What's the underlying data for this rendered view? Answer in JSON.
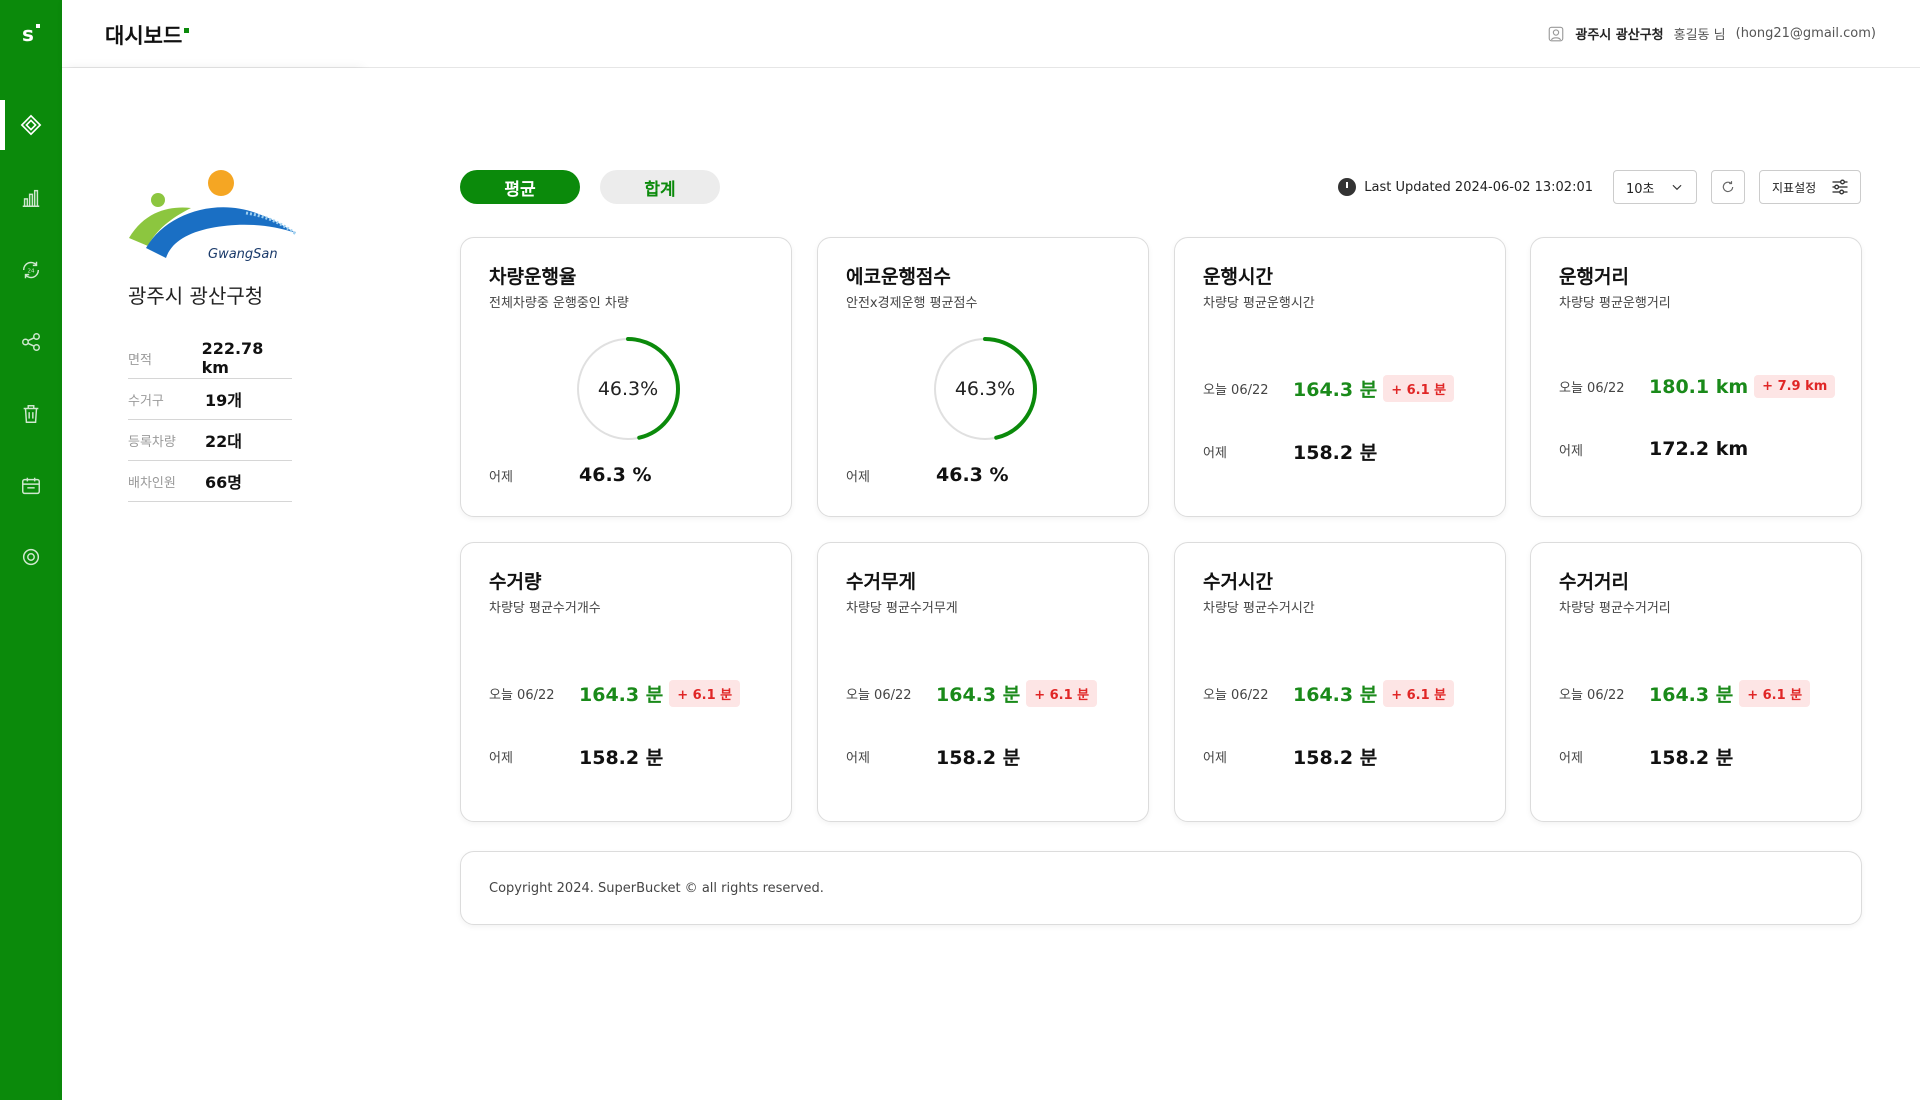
{
  "app": {
    "brand": "s",
    "page_title": "대시보드"
  },
  "user": {
    "org": "광주시 광산구청",
    "name": "홍길동 님",
    "email": "(hong21@gmail.com)"
  },
  "rail": {
    "items": [
      {
        "icon": "dashboard-icon",
        "active": true
      },
      {
        "icon": "bar-chart-icon",
        "active": false
      },
      {
        "icon": "refresh-24-icon",
        "active": false
      },
      {
        "icon": "network-icon",
        "active": false
      },
      {
        "icon": "trash-icon",
        "active": false
      },
      {
        "icon": "calendar-icon",
        "active": false
      },
      {
        "icon": "gear-icon",
        "active": false
      }
    ]
  },
  "panel": {
    "logo_text": "GwangSan",
    "org_name": "광주시 광산구청",
    "stats": [
      {
        "label": "면적",
        "value": "222.78 km"
      },
      {
        "label": "수거구",
        "value": "19개"
      },
      {
        "label": "등록차량",
        "value": "22대"
      },
      {
        "label": "배차인원",
        "value": "66명"
      }
    ]
  },
  "tabs": {
    "average": "평균",
    "total": "합계"
  },
  "toolbar": {
    "last_updated": "Last Updated 2024-06-02 13:02:01",
    "interval": "10초",
    "settings_label": "지표설정"
  },
  "colors": {
    "brand": "#0b8a0b",
    "positive": "#1a8a1a",
    "delta": "#e02626",
    "delta_bg": "#fde5e5"
  },
  "cards": [
    {
      "title": "차량운행율",
      "subtitle": "전체차량중 운행중인 차량",
      "type": "gauge",
      "gauge_percent": 46.3,
      "gauge_label": "46.3%",
      "yesterday_label": "어제",
      "yesterday_value": "46.3 %"
    },
    {
      "title": "에코운행점수",
      "subtitle": "안전x경제운행 평균점수",
      "type": "gauge",
      "gauge_percent": 46.3,
      "gauge_label": "46.3%",
      "yesterday_label": "어제",
      "yesterday_value": "46.3 %"
    },
    {
      "title": "운행시간",
      "subtitle": "차량당 평균운행시간",
      "type": "compare",
      "today_label": "오늘 06/22",
      "today_value": "164.3 분",
      "delta": "+ 6.1 분",
      "yesterday_label": "어제",
      "yesterday_value": "158.2 분"
    },
    {
      "title": "운행거리",
      "subtitle": "차량당 평균운행거리",
      "type": "compare",
      "today_label": "오늘 06/22",
      "today_value": "180.1 km",
      "delta": "+ 7.9 km",
      "yesterday_label": "어제",
      "yesterday_value": "172.2 km"
    },
    {
      "title": "수거량",
      "subtitle": "차량당 평균수거개수",
      "type": "compare",
      "today_label": "오늘 06/22",
      "today_value": "164.3 분",
      "delta": "+ 6.1 분",
      "yesterday_label": "어제",
      "yesterday_value": "158.2 분"
    },
    {
      "title": "수거무게",
      "subtitle": "차량당 평균수거무게",
      "type": "compare",
      "today_label": "오늘 06/22",
      "today_value": "164.3 분",
      "delta": "+ 6.1 분",
      "yesterday_label": "어제",
      "yesterday_value": "158.2 분"
    },
    {
      "title": "수거시간",
      "subtitle": "차량당 평균수거시간",
      "type": "compare",
      "today_label": "오늘 06/22",
      "today_value": "164.3 분",
      "delta": "+ 6.1 분",
      "yesterday_label": "어제",
      "yesterday_value": "158.2 분"
    },
    {
      "title": "수거거리",
      "subtitle": "차량당 평균수거거리",
      "type": "compare",
      "today_label": "오늘 06/22",
      "today_value": "164.3 분",
      "delta": "+ 6.1 분",
      "yesterday_label": "어제",
      "yesterday_value": "158.2 분"
    }
  ],
  "footer": {
    "copyright": "Copyright 2024. SuperBucket © all rights reserved."
  }
}
